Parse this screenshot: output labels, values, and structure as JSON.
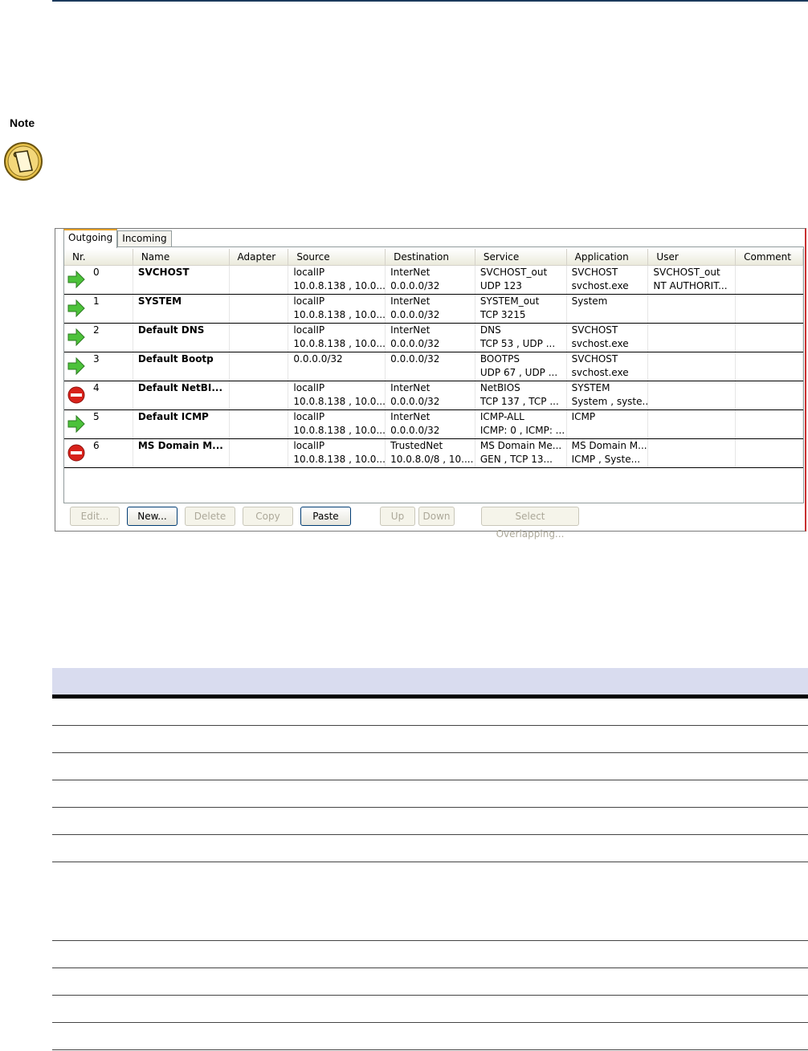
{
  "note": {
    "label": "Note",
    "icon": "note-pad-icon"
  },
  "rules_panel": {
    "tabs": [
      "Outgoing",
      "Incoming"
    ],
    "columns": [
      "Nr.",
      "Name",
      "Adapter",
      "Source",
      "Destination",
      "Service",
      "Application",
      "User",
      "Comment"
    ],
    "rows": [
      {
        "nr": "0",
        "action": "allow",
        "name": "SVCHOST",
        "adapter": "",
        "source": [
          "localIP",
          "10.0.8.138 , 10.0...."
        ],
        "destination": [
          "InterNet",
          "0.0.0.0/32"
        ],
        "service": [
          "SVCHOST_out",
          "UDP  123"
        ],
        "application": [
          "SVCHOST",
          "svchost.exe"
        ],
        "user": [
          "SVCHOST_out",
          "NT AUTHORIT..."
        ],
        "comment": ""
      },
      {
        "nr": "1",
        "action": "allow",
        "name": "SYSTEM",
        "adapter": "",
        "source": [
          "localIP",
          "10.0.8.138 , 10.0...."
        ],
        "destination": [
          "InterNet",
          "0.0.0.0/32"
        ],
        "service": [
          "SYSTEM_out",
          "TCP  3215"
        ],
        "application": [
          "System",
          ""
        ],
        "user": [
          "",
          ""
        ],
        "comment": ""
      },
      {
        "nr": "2",
        "action": "allow",
        "name": "Default DNS",
        "adapter": "",
        "source": [
          "localIP",
          "10.0.8.138 , 10.0...."
        ],
        "destination": [
          "InterNet",
          "0.0.0.0/32"
        ],
        "service": [
          "DNS",
          "TCP  53 , UDP  ..."
        ],
        "application": [
          "SVCHOST",
          "svchost.exe"
        ],
        "user": [
          "",
          ""
        ],
        "comment": ""
      },
      {
        "nr": "3",
        "action": "allow",
        "name": "Default Bootp",
        "adapter": "",
        "source": [
          "0.0.0.0/32",
          ""
        ],
        "destination": [
          "0.0.0.0/32",
          ""
        ],
        "service": [
          "BOOTPS",
          "UDP  67 , UDP  ..."
        ],
        "application": [
          "SVCHOST",
          "svchost.exe"
        ],
        "user": [
          "",
          ""
        ],
        "comment": ""
      },
      {
        "nr": "4",
        "action": "block",
        "name": "Default NetBI...",
        "adapter": "",
        "source": [
          "localIP",
          "10.0.8.138 , 10.0...."
        ],
        "destination": [
          "InterNet",
          "0.0.0.0/32"
        ],
        "service": [
          "NetBIOS",
          "TCP  137 , TCP  ..."
        ],
        "application": [
          "SYSTEM",
          "System , syste..."
        ],
        "user": [
          "",
          ""
        ],
        "comment": ""
      },
      {
        "nr": "5",
        "action": "allow",
        "name": "Default ICMP",
        "adapter": "",
        "source": [
          "localIP",
          "10.0.8.138 , 10.0...."
        ],
        "destination": [
          "InterNet",
          "0.0.0.0/32"
        ],
        "service": [
          "ICMP-ALL",
          "ICMP: 0 , ICMP: ..."
        ],
        "application": [
          "ICMP",
          ""
        ],
        "user": [
          "",
          ""
        ],
        "comment": ""
      },
      {
        "nr": "6",
        "action": "block",
        "name": "MS Domain M...",
        "adapter": "",
        "source": [
          "localIP",
          "10.0.8.138 , 10.0...."
        ],
        "destination": [
          "TrustedNet",
          "10.0.8.0/8 , 10...."
        ],
        "service": [
          "MS Domain Me...",
          "GEN  , TCP  13..."
        ],
        "application": [
          "MS Domain M...",
          "ICMP , Syste..."
        ],
        "user": [
          "",
          ""
        ],
        "comment": ""
      }
    ],
    "buttons": [
      {
        "label": "Edit...",
        "enabled": false
      },
      {
        "label": "New...",
        "enabled": true
      },
      {
        "label": "Delete",
        "enabled": false
      },
      {
        "label": "Copy",
        "enabled": false
      },
      {
        "label": "Paste",
        "enabled": true
      },
      {
        "label": "Up",
        "enabled": false
      },
      {
        "label": "Down",
        "enabled": false
      },
      {
        "label": "Select Overlapping...",
        "enabled": false
      }
    ],
    "colors": {
      "allow_arrow": "#4cc23a",
      "block_icon": "#d8221b",
      "active_tab_accent": "#e6a22b"
    }
  }
}
